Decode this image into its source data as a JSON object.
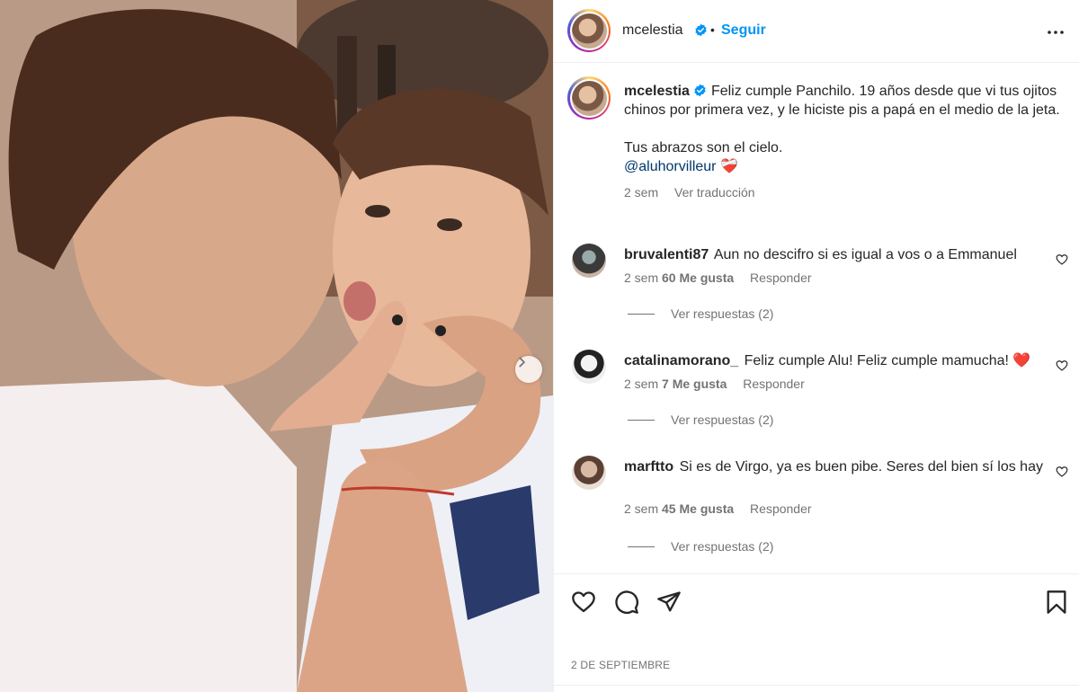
{
  "post": {
    "username": "mcelestia",
    "follow_label": "Seguir",
    "separator": "•",
    "caption_line1": "Feliz cumple Panchilo. 19 años desde que vi tus ojitos chinos por primera vez, y le hiciste pis a papá en el medio de la jeta.",
    "caption_line2": "Tus abrazos son el cielo.",
    "caption_mention": "@aluhorvilleur",
    "caption_emoji": "❤️‍🩹",
    "caption_time": "2 sem",
    "translate_label": "Ver traducción",
    "date": "2 DE SEPTIEMBRE"
  },
  "comments": [
    {
      "username": "bruvalenti87",
      "text": "Aun no descifro si es igual a vos o a Emmanuel",
      "time": "2 sem",
      "likes": "60 Me gusta",
      "reply_label": "Responder",
      "view_replies": "Ver respuestas (2)"
    },
    {
      "username": "catalinamorano_",
      "text": "Feliz cumple Alu! Feliz cumple mamucha! ❤️",
      "time": "2 sem",
      "likes": "7 Me gusta",
      "reply_label": "Responder",
      "view_replies": "Ver respuestas (2)"
    },
    {
      "username": "marftto",
      "text": "Si es de Virgo, ya es buen pibe. Seres del bien sí los hay",
      "time": "2 sem",
      "likes": "45 Me gusta",
      "reply_label": "Responder",
      "view_replies": "Ver respuestas (2)"
    }
  ],
  "icons": {
    "verified": "verified-badge-icon",
    "more": "more-options-icon",
    "like": "heart-icon",
    "comment": "comment-icon",
    "share": "send-icon",
    "save": "bookmark-icon",
    "next": "chevron-right-icon"
  },
  "colors": {
    "accent": "#0095f6",
    "text": "#262626",
    "muted": "#737373",
    "mention": "#00376b",
    "heart_red": "#ed4956"
  }
}
